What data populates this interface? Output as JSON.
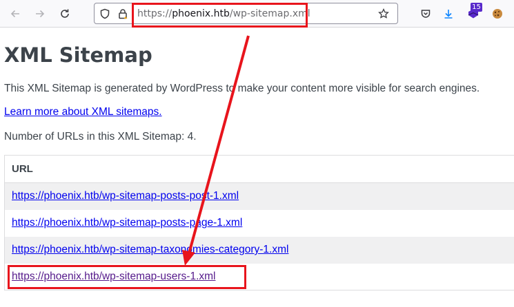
{
  "browser": {
    "url_scheme": "https://",
    "url_host": "phoenix.htb",
    "url_path": "/wp-sitemap.xml",
    "extension_badge": "15",
    "icons": [
      "back-arrow-icon",
      "forward-arrow-icon",
      "reload-icon",
      "shield-icon",
      "lock-icon",
      "star-icon",
      "pocket-icon",
      "download-icon",
      "extension-icon",
      "cookie-icon"
    ],
    "accent_color": "#592acb"
  },
  "page": {
    "title": "XML Sitemap",
    "description": "This XML Sitemap is generated by WordPress to make your content more visible for search engines.",
    "learn_more_link": "Learn more about XML sitemaps.",
    "url_count_text": "Number of URLs in this XML Sitemap: 4."
  },
  "table": {
    "header": "URL",
    "rows": [
      "https://phoenix.htb/wp-sitemap-posts-post-1.xml",
      "https://phoenix.htb/wp-sitemap-posts-page-1.xml",
      "https://phoenix.htb/wp-sitemap-taxonomies-category-1.xml",
      "https://phoenix.htb/wp-sitemap-users-1.xml"
    ]
  },
  "annotations": {
    "highlight_color": "#e8141c"
  }
}
